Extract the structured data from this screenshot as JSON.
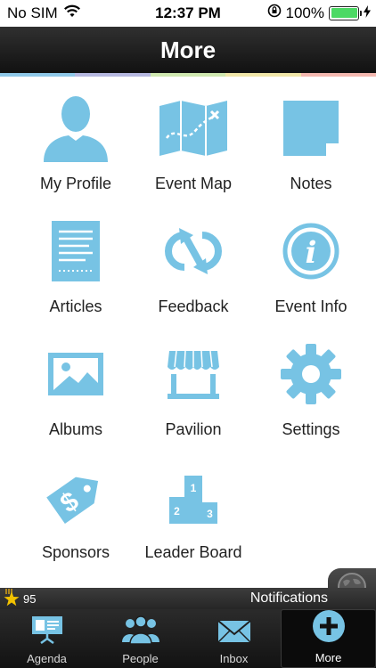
{
  "status_bar": {
    "carrier": "No SIM",
    "time": "12:37 PM",
    "battery": "100%",
    "battery_level": 1.0
  },
  "header": {
    "title": "More",
    "strip_colors": [
      "#8fc8e8",
      "#b6b8e0",
      "#cfe8b0",
      "#f0e6a8",
      "#f4b8b0"
    ]
  },
  "accent_color": "#77c3e4",
  "grid": {
    "items": [
      {
        "label": "My Profile",
        "icon": "profile-icon"
      },
      {
        "label": "Event Map",
        "icon": "map-icon"
      },
      {
        "label": "Notes",
        "icon": "notes-icon"
      },
      {
        "label": "Articles",
        "icon": "article-icon"
      },
      {
        "label": "Feedback",
        "icon": "feedback-icon"
      },
      {
        "label": "Event Info",
        "icon": "info-icon"
      },
      {
        "label": "Albums",
        "icon": "album-icon"
      },
      {
        "label": "Pavilion",
        "icon": "pavilion-icon"
      },
      {
        "label": "Settings",
        "icon": "gear-icon"
      },
      {
        "label": "Sponsors",
        "icon": "price-tag-icon"
      },
      {
        "label": "Leader Board",
        "icon": "podium-icon"
      }
    ],
    "podium_numbers": [
      "1",
      "2",
      "3"
    ],
    "info_glyph": "i"
  },
  "notifications": {
    "points": "95",
    "label": "Notifications"
  },
  "tab_bar": {
    "tabs": [
      {
        "label": "Agenda",
        "icon": "presentation-icon"
      },
      {
        "label": "People",
        "icon": "people-icon"
      },
      {
        "label": "Inbox",
        "icon": "envelope-icon"
      },
      {
        "label": "More",
        "icon": "plus-circle-icon"
      }
    ],
    "active": "More"
  }
}
